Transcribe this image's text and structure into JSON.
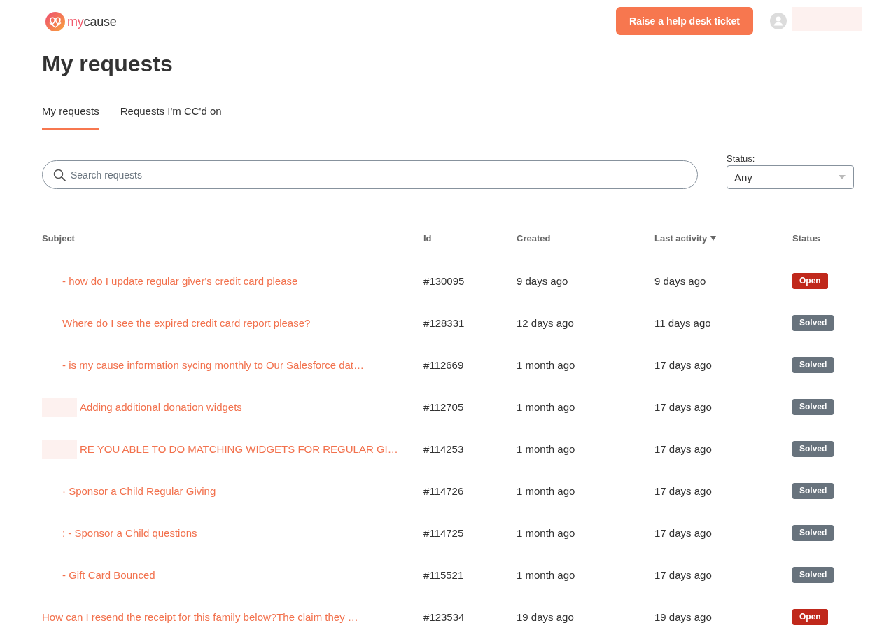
{
  "header": {
    "logo": {
      "brand": [
        "my",
        "cause"
      ]
    },
    "action_button": "Raise a help desk ticket",
    "user": {
      "redacted": true
    }
  },
  "page_title": "My requests",
  "tabs": [
    {
      "label": "My requests",
      "selected": true
    },
    {
      "label": "Requests I'm CC'd on",
      "selected": false
    }
  ],
  "search": {
    "placeholder": "Search requests"
  },
  "status_filter": {
    "label": "Status:",
    "value": "Any"
  },
  "table": {
    "columns": [
      {
        "label": "Subject",
        "sorted": false
      },
      {
        "label": "Id",
        "sorted": false
      },
      {
        "label": "Created",
        "sorted": false
      },
      {
        "label": "Last activity",
        "sorted": true
      },
      {
        "label": "Status",
        "sorted": false
      }
    ],
    "rows": [
      {
        "kind": "indented",
        "subject": "- how do I update regular giver's credit card please",
        "id": "#130095",
        "created": "9 days ago",
        "last_activity": "9 days ago",
        "status": {
          "label": "Open",
          "color": "#c0281b"
        }
      },
      {
        "kind": "indented",
        "subject": "Where do I see the expired credit card report please?",
        "id": "#128331",
        "created": "12 days ago",
        "last_activity": "11 days ago",
        "status": {
          "label": "Solved",
          "color": "#68737d"
        }
      },
      {
        "kind": "indented",
        "subject": "- is my cause information sycing monthly to Our Salesforce dat…",
        "id": "#112669",
        "created": "1 month ago",
        "last_activity": "17 days ago",
        "status": {
          "label": "Solved",
          "color": "#68737d"
        }
      },
      {
        "kind": "redacted",
        "subject": "Adding additional donation widgets",
        "id": "#112705",
        "created": "1 month ago",
        "last_activity": "17 days ago",
        "status": {
          "label": "Solved",
          "color": "#68737d"
        }
      },
      {
        "kind": "redacted",
        "subject": "RE YOU ABLE TO DO MATCHING WIDGETS FOR REGULAR GI…",
        "id": "#114253",
        "created": "1 month ago",
        "last_activity": "17 days ago",
        "status": {
          "label": "Solved",
          "color": "#68737d"
        }
      },
      {
        "kind": "indented",
        "subject": "· Sponsor a Child Regular Giving",
        "id": "#114726",
        "created": "1 month ago",
        "last_activity": "17 days ago",
        "status": {
          "label": "Solved",
          "color": "#68737d"
        }
      },
      {
        "kind": "indented",
        "subject": ": - Sponsor a Child questions",
        "id": "#114725",
        "created": "1 month ago",
        "last_activity": "17 days ago",
        "status": {
          "label": "Solved",
          "color": "#68737d"
        }
      },
      {
        "kind": "indented",
        "subject": "- Gift Card Bounced",
        "id": "#115521",
        "created": "1 month ago",
        "last_activity": "17 days ago",
        "status": {
          "label": "Solved",
          "color": "#68737d"
        }
      },
      {
        "kind": "plain",
        "subject": "How can I resend the receipt for this family below?The claim they …",
        "id": "#123534",
        "created": "19 days ago",
        "last_activity": "19 days ago",
        "status": {
          "label": "Open",
          "color": "#c0281b"
        }
      }
    ]
  }
}
